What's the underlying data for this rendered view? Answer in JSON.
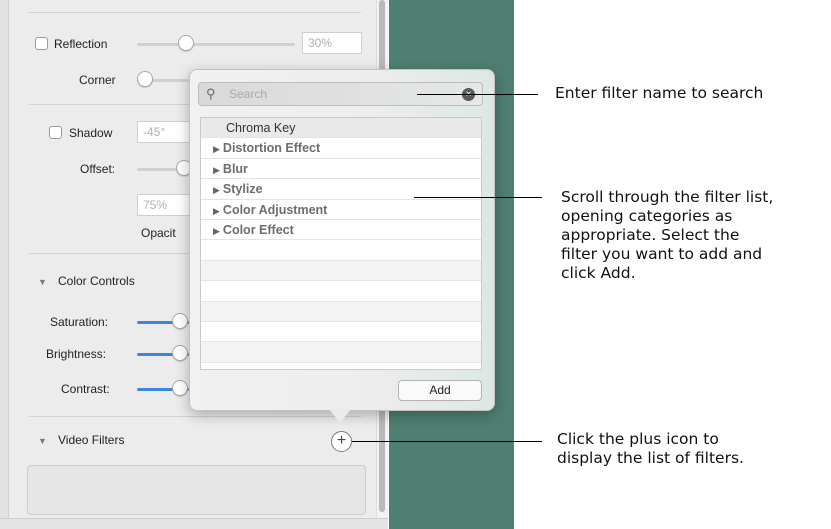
{
  "panel": {
    "reflection_label": "Reflection",
    "reflection_value": "30%",
    "corner_label": "Corner",
    "shadow_label": "Shadow",
    "shadow_angle": "-45°",
    "offset_label": "Offset:",
    "shadow_opacity_value": "75%",
    "opacity_label": "Opacit",
    "color_controls_label": "Color Controls",
    "saturation_label": "Saturation:",
    "brightness_label": "Brightness:",
    "contrast_label": "Contrast:",
    "video_filters_label": "Video Filters",
    "plus_symbol": "+"
  },
  "popover": {
    "search_placeholder": "Search",
    "header_row": "Chroma Key",
    "categories": [
      "Distortion Effect",
      "Blur",
      "Stylize",
      "Color Adjustment",
      "Color Effect"
    ],
    "add_label": "Add"
  },
  "callouts": {
    "search": "Enter filter name to search",
    "list_lines": [
      "Scroll through the filter list,",
      "opening categories as",
      "appropriate. Select the",
      "filter you want to add and",
      "click Add."
    ],
    "plus_lines": [
      "Click the plus icon to",
      "display the list of filters."
    ]
  },
  "colors": {
    "teal_background": "#4f7f72",
    "slider_blue": "#3b87e0"
  }
}
